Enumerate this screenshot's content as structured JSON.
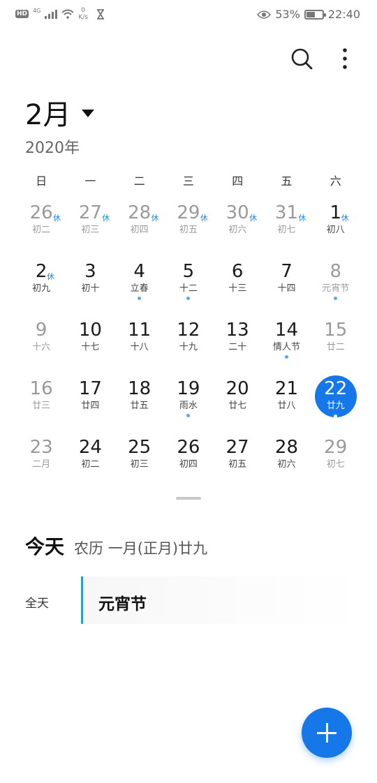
{
  "status_bar": {
    "hd": "HD",
    "network": "4G",
    "speed_value": "0",
    "speed_unit": "K/s",
    "battery_percent": "53%",
    "battery_level": 0.53,
    "time": "22:40"
  },
  "header": {
    "month": "2月",
    "year": "2020年"
  },
  "weekdays": [
    "日",
    "一",
    "二",
    "三",
    "四",
    "五",
    "六"
  ],
  "calendar": [
    [
      {
        "num": "26",
        "lunar": "初二",
        "badge": "休",
        "other": true
      },
      {
        "num": "27",
        "lunar": "初三",
        "badge": "休",
        "other": true
      },
      {
        "num": "28",
        "lunar": "初四",
        "badge": "休",
        "other": true
      },
      {
        "num": "29",
        "lunar": "初五",
        "badge": "休",
        "other": true
      },
      {
        "num": "30",
        "lunar": "初六",
        "badge": "休",
        "other": true
      },
      {
        "num": "31",
        "lunar": "初七",
        "badge": "休",
        "other": true
      },
      {
        "num": "1",
        "lunar": "初八",
        "badge": "休"
      }
    ],
    [
      {
        "num": "2",
        "lunar": "初九",
        "badge": "休"
      },
      {
        "num": "3",
        "lunar": "初十"
      },
      {
        "num": "4",
        "lunar": "立春",
        "dot": true
      },
      {
        "num": "5",
        "lunar": "十二",
        "dot": true
      },
      {
        "num": "6",
        "lunar": "十三"
      },
      {
        "num": "7",
        "lunar": "十四"
      },
      {
        "num": "8",
        "lunar": "元宵节",
        "dot": true,
        "muted": true
      }
    ],
    [
      {
        "num": "9",
        "lunar": "十六",
        "muted": true
      },
      {
        "num": "10",
        "lunar": "十七"
      },
      {
        "num": "11",
        "lunar": "十八"
      },
      {
        "num": "12",
        "lunar": "十九"
      },
      {
        "num": "13",
        "lunar": "二十"
      },
      {
        "num": "14",
        "lunar": "情人节",
        "dot": true
      },
      {
        "num": "15",
        "lunar": "廿二",
        "muted": true
      }
    ],
    [
      {
        "num": "16",
        "lunar": "廿三",
        "muted": true
      },
      {
        "num": "17",
        "lunar": "廿四"
      },
      {
        "num": "18",
        "lunar": "廿五"
      },
      {
        "num": "19",
        "lunar": "雨水",
        "dot": true
      },
      {
        "num": "20",
        "lunar": "廿七"
      },
      {
        "num": "21",
        "lunar": "廿八"
      },
      {
        "num": "22",
        "lunar": "廿九",
        "dot": true,
        "today": true
      }
    ],
    [
      {
        "num": "23",
        "lunar": "二月",
        "muted": true
      },
      {
        "num": "24",
        "lunar": "初二"
      },
      {
        "num": "25",
        "lunar": "初三"
      },
      {
        "num": "26",
        "lunar": "初四"
      },
      {
        "num": "27",
        "lunar": "初五"
      },
      {
        "num": "28",
        "lunar": "初六"
      },
      {
        "num": "29",
        "lunar": "初七",
        "muted": true
      }
    ]
  ],
  "today_section": {
    "title": "今天",
    "lunar": "农历 一月(正月)廿九"
  },
  "event": {
    "when": "全天",
    "title": "元宵节"
  },
  "icons": {
    "search": "search-icon",
    "more": "more-vertical-icon",
    "add": "add-icon"
  },
  "colors": {
    "accent": "#1677e8",
    "event_bar": "#26a2c9",
    "badge": "#1e88e5"
  }
}
